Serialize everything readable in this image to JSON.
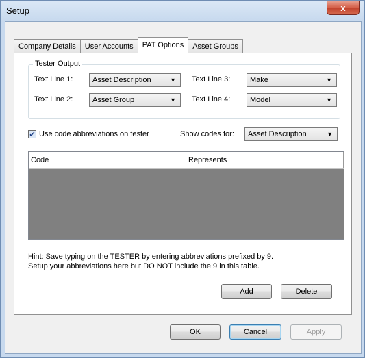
{
  "window": {
    "title": "Setup",
    "close_label": "x"
  },
  "tabs": [
    {
      "label": "Company Details"
    },
    {
      "label": "User Accounts"
    },
    {
      "label": "PAT Options"
    },
    {
      "label": "Asset Groups"
    }
  ],
  "tester_output": {
    "legend": "Tester Output",
    "lines": [
      {
        "label": "Text Line 1:",
        "value": "Asset Description"
      },
      {
        "label": "Text Line 2:",
        "value": "Asset Group"
      },
      {
        "label": "Text Line 3:",
        "value": "Make"
      },
      {
        "label": "Text Line 4:",
        "value": "Model"
      }
    ]
  },
  "abbreviations": {
    "checkbox_label": "Use code abbreviations on tester",
    "checked": true,
    "show_codes_label": "Show codes for:",
    "show_codes_value": "Asset Description"
  },
  "grid": {
    "columns": [
      "Code",
      "Represents"
    ]
  },
  "hint": {
    "line1": "Hint: Save typing on the TESTER by entering abbreviations prefixed by 9.",
    "line2": "Setup your abbreviations here but DO NOT include the 9 in this table."
  },
  "buttons": {
    "add": "Add",
    "delete": "Delete",
    "ok": "OK",
    "cancel": "Cancel",
    "apply": "Apply"
  },
  "icons": {
    "dropdown": "chevron-down-icon",
    "check": "checkmark-icon"
  }
}
